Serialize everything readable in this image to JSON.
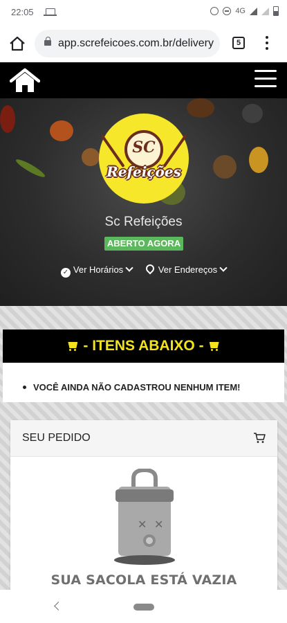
{
  "status_bar": {
    "time": "22:05",
    "network": "4G"
  },
  "browser": {
    "url": "app.screfeicoes.com.br/delivery",
    "tab_count": "5"
  },
  "store": {
    "logo_top": "SC",
    "logo_bottom": "Refeições",
    "name": "Sc Refeições",
    "status_badge": "ABERTO AGORA",
    "hours_link": "Ver Horários",
    "addresses_link": "Ver Endereços"
  },
  "items": {
    "banner": "- ITENS ABAIXO -",
    "empty_message": "VOCÊ AINDA NÃO CADASTROU NENHUM ITEM!"
  },
  "order": {
    "title": "SEU PEDIDO",
    "empty_bag": "SUA SACOLA ESTÁ VAZIA"
  },
  "colors": {
    "header_bg": "#000000",
    "banner_text": "#f4e21d",
    "badge_bg": "#5cb85c",
    "logo_bg": "#f7e72a"
  }
}
